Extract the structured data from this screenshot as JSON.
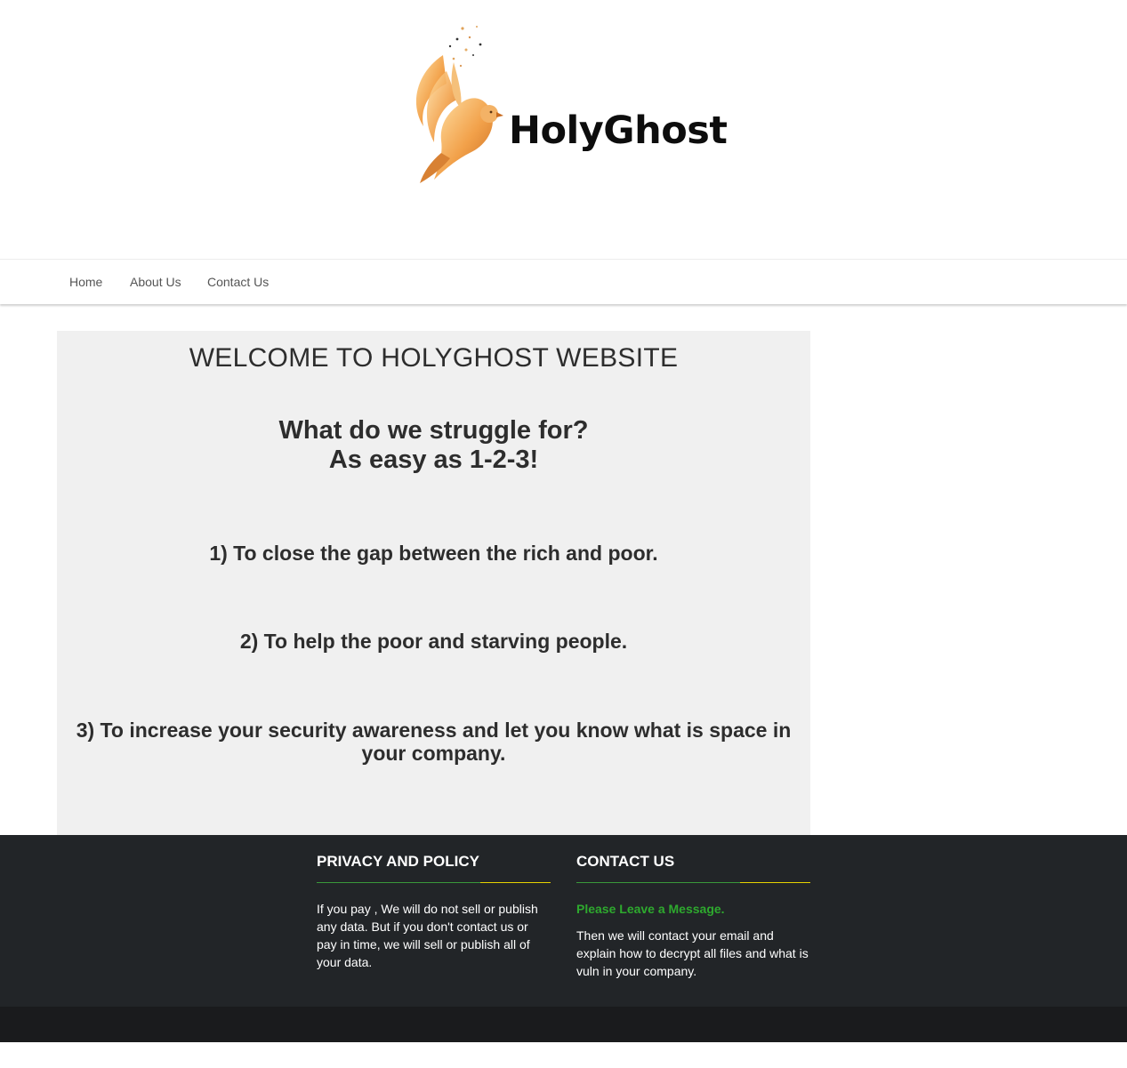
{
  "brand": {
    "name": "HolyGhost",
    "logo_icon": "dove-icon"
  },
  "nav": {
    "items": [
      {
        "label": "Home"
      },
      {
        "label": "About Us"
      },
      {
        "label": "Contact Us"
      }
    ]
  },
  "main": {
    "title": "WELCOME TO HOLYGHOST WEBSITE",
    "subtitle_line1": "What do we struggle for?",
    "subtitle_line2": "As easy as 1-2-3!",
    "goals": [
      "1) To close the gap between the rich and poor.",
      "2) To help the poor and starving people.",
      "3) To increase your security awareness and let you know what is space in your company."
    ]
  },
  "footer": {
    "privacy": {
      "heading": "PRIVACY AND POLICY",
      "text": "If you pay , We will do not sell or publish any data. But if you don't contact us or pay in time, we will sell or publish all of your data."
    },
    "contact": {
      "heading": "CONTACT US",
      "message": "Please Leave a Message.",
      "text": "Then we will contact your email and explain how to decrypt all files and what is vuln in your company."
    }
  },
  "colors": {
    "accent_green": "#2ea92e",
    "accent_yellow": "#e6d200",
    "footer_bg": "#222528",
    "content_bg": "#f0f0f0"
  }
}
